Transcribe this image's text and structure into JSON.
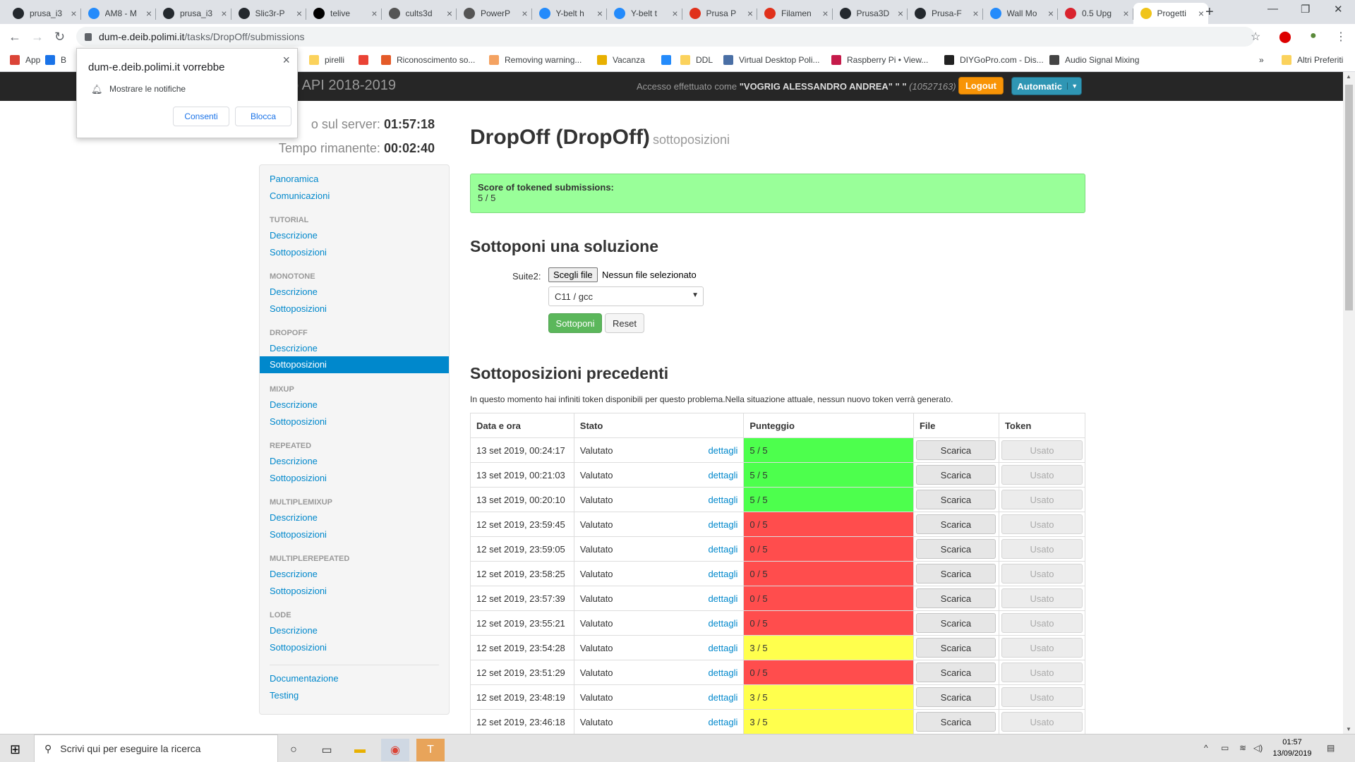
{
  "browser": {
    "tabs": [
      {
        "title": "prusa_i3",
        "icon": "github-icon",
        "color": "#24292e"
      },
      {
        "title": "AM8 - M",
        "icon": "thingiverse-icon",
        "color": "#248bfb"
      },
      {
        "title": "prusa_i3",
        "icon": "github-icon",
        "color": "#24292e"
      },
      {
        "title": "Slic3r-P",
        "icon": "github-icon",
        "color": "#24292e"
      },
      {
        "title": "telive",
        "icon": "rtl-icon",
        "color": "#000000"
      },
      {
        "title": "cults3d",
        "icon": "globe-icon",
        "color": "#555555"
      },
      {
        "title": "PowerP",
        "icon": "globe-icon",
        "color": "#555555"
      },
      {
        "title": "Y-belt h",
        "icon": "thingiverse-icon",
        "color": "#248bfb"
      },
      {
        "title": "Y-belt t",
        "icon": "thingiverse-icon",
        "color": "#248bfb"
      },
      {
        "title": "Prusa P",
        "icon": "prusa-icon",
        "color": "#e0311b"
      },
      {
        "title": "Filamen",
        "icon": "prusa-icon",
        "color": "#e0311b"
      },
      {
        "title": "Prusa3D",
        "icon": "github-icon",
        "color": "#24292e"
      },
      {
        "title": "Prusa-F",
        "icon": "github-icon",
        "color": "#24292e"
      },
      {
        "title": "Wall Mo",
        "icon": "thingiverse-icon",
        "color": "#248bfb"
      },
      {
        "title": "0.5 Upg",
        "icon": "d-icon",
        "color": "#d9232e"
      },
      {
        "title": "Progetti",
        "icon": "hand-icon",
        "color": "#f0c419"
      }
    ],
    "url_host": "dum-e.deib.polimi.it",
    "url_path": "/tasks/DropOff/submissions",
    "bookmarks": [
      {
        "label": "App",
        "icon": "apps-icon",
        "color": "#db4437"
      },
      {
        "label": "B",
        "icon": "star-icon",
        "color": "#1a73e8"
      },
      {
        "label": "pirelli",
        "icon": "folder-icon",
        "color": "#fbd25c"
      },
      {
        "label": "",
        "icon": "google-icon",
        "color": "#ea4335"
      },
      {
        "label": "Riconoscimento so...",
        "icon": "globe-icon",
        "color": "#e45a28"
      },
      {
        "label": "Removing warning...",
        "icon": "globe-icon",
        "color": "#f4a261"
      },
      {
        "label": "Vacanza",
        "icon": "sun-icon",
        "color": "#e8b000"
      },
      {
        "label": "",
        "icon": "thingiverse-icon",
        "color": "#248bfb"
      },
      {
        "label": "DDL",
        "icon": "folder-icon",
        "color": "#fbd25c"
      },
      {
        "label": "Virtual Desktop Poli...",
        "icon": "globe-icon",
        "color": "#4a6fa5"
      },
      {
        "label": "Raspberry Pi • View...",
        "icon": "raspberry-icon",
        "color": "#c51a4a"
      },
      {
        "label": "DIYGoPro.com - Dis...",
        "icon": "globe-icon",
        "color": "#222222"
      },
      {
        "label": "Audio Signal Mixing",
        "icon": "globe-icon",
        "color": "#444444"
      },
      {
        "label": "Altri Preferiti",
        "icon": "folder-icon",
        "color": "#fbd25c"
      }
    ],
    "bookmarks_more": "»"
  },
  "notification": {
    "title": "dum-e.deib.polimi.it vorrebbe",
    "message": "Mostrare le notifiche",
    "allow": "Consenti",
    "block": "Blocca",
    "close": "×"
  },
  "header": {
    "title": "o API 2018-2019",
    "login_prefix": "Accesso effettuato come ",
    "login_user": "\"VOGRIG ALESSANDRO ANDREA\" \" \"",
    "login_id": "(10527163)",
    "logout": "Logout",
    "automatic": "Automatic"
  },
  "timer": {
    "server_label": "o sul server:",
    "server_value": "01:57:18",
    "remaining_label": "Tempo rimanente:",
    "remaining_value": "00:02:40"
  },
  "sidebar": {
    "top": [
      "Panoramica",
      "Comunicazioni"
    ],
    "groups": [
      {
        "head": "TUTORIAL",
        "items": [
          "Descrizione",
          "Sottoposizioni"
        ]
      },
      {
        "head": "MONOTONE",
        "items": [
          "Descrizione",
          "Sottoposizioni"
        ]
      },
      {
        "head": "DROPOFF",
        "items": [
          "Descrizione",
          "Sottoposizioni"
        ]
      },
      {
        "head": "MIXUP",
        "items": [
          "Descrizione",
          "Sottoposizioni"
        ]
      },
      {
        "head": "REPEATED",
        "items": [
          "Descrizione",
          "Sottoposizioni"
        ]
      },
      {
        "head": "MULTIPLEMIXUP",
        "items": [
          "Descrizione",
          "Sottoposizioni"
        ]
      },
      {
        "head": "MULTIPLEREPEATED",
        "items": [
          "Descrizione",
          "Sottoposizioni"
        ]
      },
      {
        "head": "LODE",
        "items": [
          "Descrizione",
          "Sottoposizioni"
        ]
      }
    ],
    "bottom": [
      "Documentazione",
      "Testing"
    ]
  },
  "main": {
    "title": "DropOff (DropOff)",
    "subtitle": "sottoposizioni",
    "score_label": "Score of tokened submissions:",
    "score_value": "5 / 5",
    "submit_heading": "Sottoponi una soluzione",
    "field_label": "Suite2:",
    "file_button": "Scegli file",
    "file_none": "Nessun file selezionato",
    "language": "C11 / gcc",
    "submit": "Sottoponi",
    "reset": "Reset",
    "previous_heading": "Sottoposizioni precedenti",
    "info": "In questo momento hai infiniti token disponibili per questo problema.Nella situazione attuale, nessun nuovo token verrà generato."
  },
  "table": {
    "headers": [
      "Data e ora",
      "Stato",
      "Punteggio",
      "File",
      "Token"
    ],
    "details_label": "dettagli",
    "download_label": "Scarica",
    "used_label": "Usato",
    "score_colors": {
      "full": "#4dff4d",
      "zero": "#ff4d4d",
      "partial": "#ffff4d"
    },
    "rows": [
      {
        "date": "13 set 2019, 00:24:17",
        "status": "Valutato",
        "score": "5 / 5",
        "level": "full"
      },
      {
        "date": "13 set 2019, 00:21:03",
        "status": "Valutato",
        "score": "5 / 5",
        "level": "full"
      },
      {
        "date": "13 set 2019, 00:20:10",
        "status": "Valutato",
        "score": "5 / 5",
        "level": "full"
      },
      {
        "date": "12 set 2019, 23:59:45",
        "status": "Valutato",
        "score": "0 / 5",
        "level": "zero"
      },
      {
        "date": "12 set 2019, 23:59:05",
        "status": "Valutato",
        "score": "0 / 5",
        "level": "zero"
      },
      {
        "date": "12 set 2019, 23:58:25",
        "status": "Valutato",
        "score": "0 / 5",
        "level": "zero"
      },
      {
        "date": "12 set 2019, 23:57:39",
        "status": "Valutato",
        "score": "0 / 5",
        "level": "zero"
      },
      {
        "date": "12 set 2019, 23:55:21",
        "status": "Valutato",
        "score": "0 / 5",
        "level": "zero"
      },
      {
        "date": "12 set 2019, 23:54:28",
        "status": "Valutato",
        "score": "3 / 5",
        "level": "partial"
      },
      {
        "date": "12 set 2019, 23:51:29",
        "status": "Valutato",
        "score": "0 / 5",
        "level": "zero"
      },
      {
        "date": "12 set 2019, 23:48:19",
        "status": "Valutato",
        "score": "3 / 5",
        "level": "partial"
      },
      {
        "date": "12 set 2019, 23:46:18",
        "status": "Valutato",
        "score": "3 / 5",
        "level": "partial"
      }
    ]
  },
  "taskbar": {
    "search_placeholder": "Scrivi qui per eseguire la ricerca",
    "time": "01:57",
    "date": "13/09/2019"
  }
}
